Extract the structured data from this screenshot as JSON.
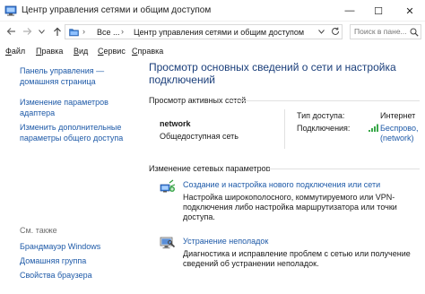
{
  "window": {
    "title": "Центр управления сетями и общим доступом",
    "minimize": "—",
    "maximize": "☐",
    "close": "✕"
  },
  "address": {
    "root_crumb": "Все ...",
    "separator": "›",
    "current_crumb": "Центр управления сетями и общим доступом",
    "search_placeholder": "Поиск в пане..."
  },
  "menu": {
    "items": [
      {
        "key": "Ф",
        "rest": "айл"
      },
      {
        "key": "П",
        "rest": "равка"
      },
      {
        "key": "В",
        "rest": "ид"
      },
      {
        "key": "С",
        "rest": "ервис"
      },
      {
        "key": "С",
        "rest": "правка"
      }
    ]
  },
  "sidebar": {
    "links": [
      "Панель управления — домашняя страница",
      "Изменение параметров адаптера",
      "Изменить дополнительные параметры общего доступа"
    ],
    "see_also_label": "См. также",
    "see_also_links": [
      "Брандмауэр Windows",
      "Домашняя группа",
      "Свойства браузера"
    ]
  },
  "main": {
    "heading": "Просмотр основных сведений о сети и настройка подключений",
    "active_networks_title": "Просмотр активных сетей",
    "network": {
      "name": "network",
      "type": "Общедоступная сеть",
      "access_type_label": "Тип доступа:",
      "access_type_value": "Интернет",
      "connections_label": "Подключения:",
      "connection_link": "Беспрово, (network)"
    },
    "change_settings_title": "Изменение сетевых параметров",
    "tasks": [
      {
        "link": "Создание и настройка нового подключения или сети",
        "desc": "Настройка широкополосного, коммутируемого или VPN-подключения либо настройка маршрутизатора или точки доступа."
      },
      {
        "link": "Устранение неполадок",
        "desc": "Диагностика и исправление проблем с сетью или получение сведений об устранении неполадок."
      }
    ]
  },
  "colors": {
    "link": "#1e5aa8",
    "heading": "#1a3e7a",
    "muted": "#6d6d6d"
  },
  "icons": [
    "network-center-icon",
    "back-arrow-icon",
    "forward-arrow-icon",
    "up-arrow-icon",
    "folder-icon",
    "refresh-icon",
    "search-icon",
    "wifi-signal-icon",
    "new-connection-icon",
    "troubleshoot-icon"
  ]
}
